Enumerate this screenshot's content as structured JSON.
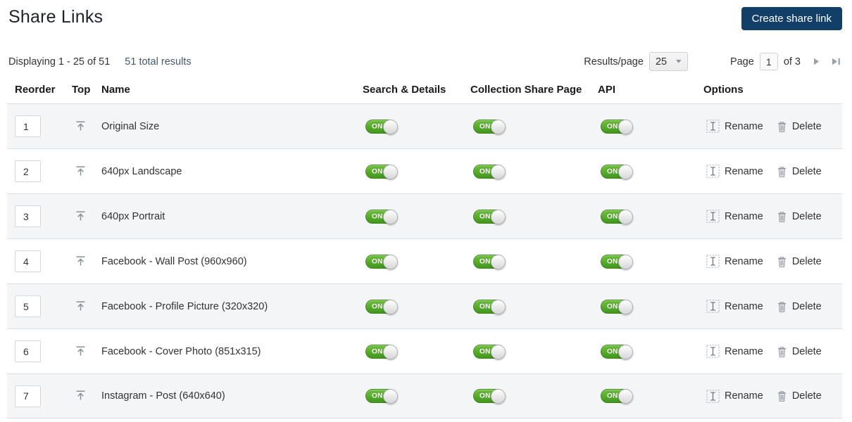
{
  "header": {
    "title": "Share Links",
    "create_button_label": "Create share link"
  },
  "controls": {
    "displaying_text": "Displaying 1 - 25 of 51",
    "total_results_link": "51 total results",
    "results_per_page_label": "Results/page",
    "results_per_page_value": "25",
    "page_label": "Page",
    "current_page": "1",
    "page_count_text": "of 3"
  },
  "table": {
    "columns": {
      "reorder": "Reorder",
      "top": "Top",
      "name": "Name",
      "search_details": "Search & Details",
      "collection_share_page": "Collection Share Page",
      "api": "API",
      "options": "Options"
    },
    "rename_label": "Rename",
    "delete_label": "Delete",
    "rows": [
      {
        "order": "1",
        "name": "Original Size",
        "search_details": "ON",
        "collection_share_page": "ON",
        "api": "ON"
      },
      {
        "order": "2",
        "name": "640px Landscape",
        "search_details": "ON",
        "collection_share_page": "ON",
        "api": "ON"
      },
      {
        "order": "3",
        "name": "640px Portrait",
        "search_details": "ON",
        "collection_share_page": "ON",
        "api": "ON"
      },
      {
        "order": "4",
        "name": "Facebook - Wall Post (960x960)",
        "search_details": "ON",
        "collection_share_page": "ON",
        "api": "ON"
      },
      {
        "order": "5",
        "name": "Facebook - Profile Picture (320x320)",
        "search_details": "ON",
        "collection_share_page": "ON",
        "api": "ON"
      },
      {
        "order": "6",
        "name": "Facebook - Cover Photo (851x315)",
        "search_details": "ON",
        "collection_share_page": "ON",
        "api": "ON"
      },
      {
        "order": "7",
        "name": "Instagram - Post (640x640)",
        "search_details": "ON",
        "collection_share_page": "ON",
        "api": "ON"
      }
    ]
  },
  "colors": {
    "accent_navy": "#123f68",
    "toggle_green": "#4ea125",
    "link_color": "#44586e",
    "alt_row_bg": "#f4f5f7"
  }
}
